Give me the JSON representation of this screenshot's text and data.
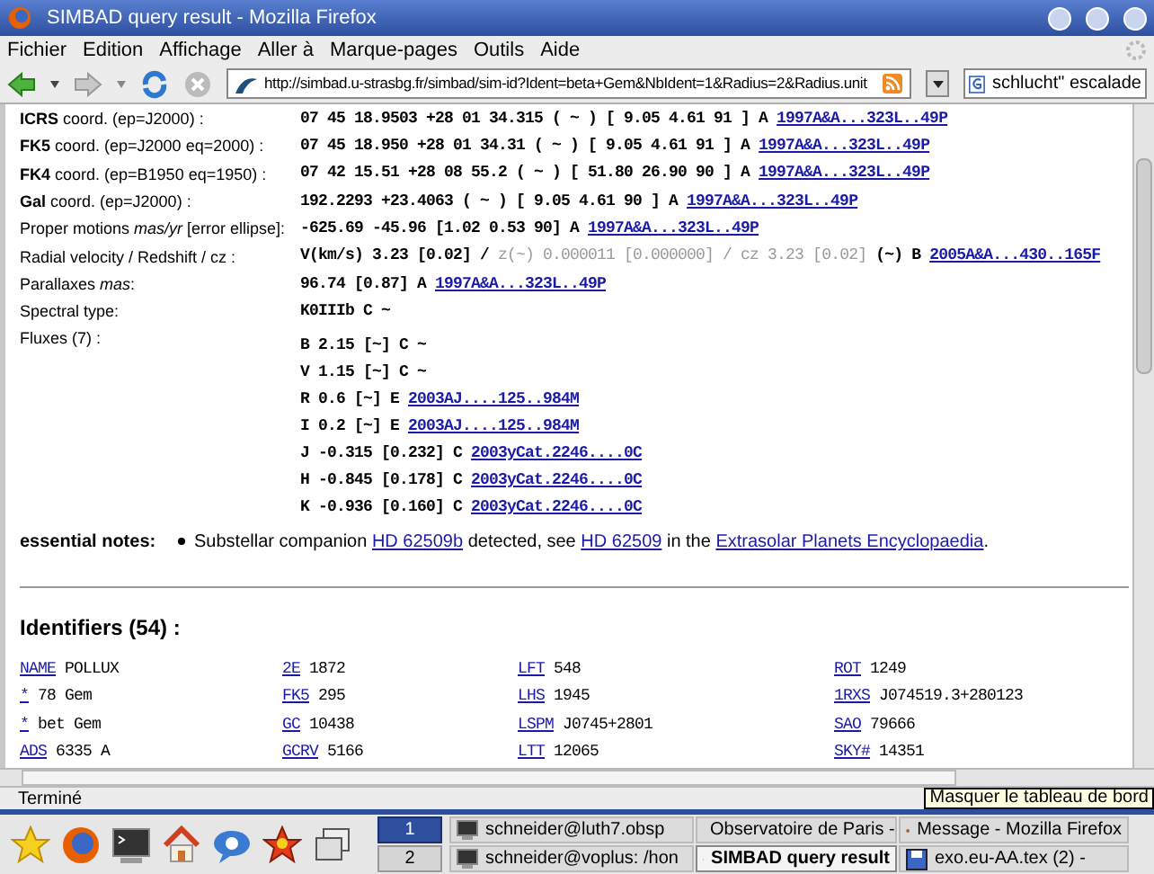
{
  "window": {
    "title": "SIMBAD query result - Mozilla Firefox"
  },
  "menu": [
    "Fichier",
    "Edition",
    "Affichage",
    "Aller à",
    "Marque-pages",
    "Outils",
    "Aide"
  ],
  "address_bar": {
    "value": "http://simbad.u-strasbg.fr/simbad/sim-id?Ident=beta+Gem&NbIdent=1&Radius=2&Radius.unit"
  },
  "search": {
    "value": "schlucht\" escalade"
  },
  "rows": [
    {
      "label": "**ICRS** coord. (ep=J2000) :",
      "segments": [
        {
          "kind": "text",
          "text": "07 45 18.9503 +28 01 34.315 ( ~ ) [ 9.05 4.61 91 ] A"
        },
        {
          "kind": "link",
          "text": "1997A&A...323L..49P"
        }
      ]
    },
    {
      "label": "**FK5** coord. (ep=J2000 eq=2000) :",
      "segments": [
        {
          "kind": "text",
          "text": "07 45 18.950 +28 01 34.31 ( ~ ) [ 9.05 4.61 91 ] A"
        },
        {
          "kind": "link",
          "text": "1997A&A...323L..49P"
        }
      ]
    },
    {
      "label": "**FK4** coord. (ep=B1950 eq=1950) :",
      "segments": [
        {
          "kind": "text",
          "text": "07 42 15.51 +28 08 55.2 ( ~ ) [ 51.80 26.90 90 ] A"
        },
        {
          "kind": "link",
          "text": "1997A&A...323L..49P"
        }
      ]
    },
    {
      "label": "**Gal** coord. (ep=J2000) :",
      "segments": [
        {
          "kind": "text",
          "text": "192.2293 +23.4063 ( ~ ) [ 9.05 4.61 90 ] A"
        },
        {
          "kind": "link",
          "text": "1997A&A...323L..49P"
        }
      ]
    },
    {
      "label": "Proper motions *mas/yr* [error ellipse]:",
      "segments": [
        {
          "kind": "text",
          "text": "-625.69 -45.96 [1.02 0.53 90] A"
        },
        {
          "kind": "link",
          "text": "1997A&A...323L..49P"
        }
      ]
    },
    {
      "label": "Radial velocity / Redshift / cz :",
      "segments": [
        {
          "kind": "text",
          "text": "V(km/s) 3.23 [0.02] /"
        },
        {
          "kind": "muted",
          "text": "z(~) 0.000011 [0.000000] / cz 3.23 [0.02]"
        },
        {
          "kind": "text",
          "text": "(~) B"
        },
        {
          "kind": "link",
          "text": "2005A&A...430..165F"
        }
      ]
    },
    {
      "label": "Parallaxes *mas*:",
      "segments": [
        {
          "kind": "text",
          "text": "96.74 [0.87] A"
        },
        {
          "kind": "link",
          "text": "1997A&A...323L..49P"
        }
      ]
    },
    {
      "label": "Spectral type:",
      "segments": [
        {
          "kind": "text",
          "text": "K0IIIb C ~"
        }
      ]
    }
  ],
  "fluxes": {
    "label": "Fluxes (7) :",
    "lines": [
      [
        {
          "kind": "text",
          "text": "B 2.15 [~] C ~"
        }
      ],
      [
        {
          "kind": "text",
          "text": "V 1.15 [~] C ~"
        }
      ],
      [
        {
          "kind": "text",
          "text": "R 0.6 [~] E"
        },
        {
          "kind": "link",
          "text": "2003AJ....125..984M"
        }
      ],
      [
        {
          "kind": "text",
          "text": "I 0.2 [~] E"
        },
        {
          "kind": "link",
          "text": "2003AJ....125..984M"
        }
      ],
      [
        {
          "kind": "text",
          "text": "J -0.315 [0.232] C"
        },
        {
          "kind": "link",
          "text": "2003yCat.2246....0C"
        }
      ],
      [
        {
          "kind": "text",
          "text": "H -0.845 [0.178] C"
        },
        {
          "kind": "link",
          "text": "2003yCat.2246....0C"
        }
      ],
      [
        {
          "kind": "text",
          "text": "K -0.936 [0.160] C"
        },
        {
          "kind": "link",
          "text": "2003yCat.2246....0C"
        }
      ]
    ]
  },
  "notes": {
    "label": "essential notes:",
    "items": [
      [
        {
          "kind": "text",
          "text": "Substellar companion "
        },
        {
          "kind": "link",
          "text": "HD 62509b"
        },
        {
          "kind": "text",
          "text": " detected, see "
        },
        {
          "kind": "link",
          "text": "HD 62509"
        },
        {
          "kind": "text",
          "text": " in the "
        },
        {
          "kind": "link",
          "text": "Extrasolar Planets Encyclopaedia"
        },
        {
          "kind": "text",
          "text": "."
        }
      ]
    ]
  },
  "identifiers": {
    "heading": "Identifiers (54) :",
    "items": [
      {
        "catalog": "NAME",
        "value": "POLLUX"
      },
      {
        "catalog": "2E",
        "value": "1872"
      },
      {
        "catalog": "LFT",
        "value": "548"
      },
      {
        "catalog": "ROT",
        "value": "1249"
      },
      {
        "catalog": "*",
        "value": "78 Gem"
      },
      {
        "catalog": "FK5",
        "value": "295"
      },
      {
        "catalog": "LHS",
        "value": "1945"
      },
      {
        "catalog": "1RXS",
        "value": "J074519.3+280123"
      },
      {
        "catalog": "*",
        "value": "bet Gem"
      },
      {
        "catalog": "GC",
        "value": "10438"
      },
      {
        "catalog": "LSPM",
        "value": "J0745+2801"
      },
      {
        "catalog": "SAO",
        "value": "79666"
      },
      {
        "catalog": "ADS",
        "value": "6335 A"
      },
      {
        "catalog": "GCRV",
        "value": "5166"
      },
      {
        "catalog": "LTT",
        "value": "12065"
      },
      {
        "catalog": "SKY#",
        "value": "14351"
      }
    ]
  },
  "status_bar": "Terminé",
  "taskbar": {
    "pager": [
      {
        "label": "1",
        "selected": true
      },
      {
        "label": "2",
        "selected": false
      }
    ],
    "tasks": [
      {
        "label": "schneider@luth7.obsp",
        "kind": "terminal",
        "selected": false
      },
      {
        "label": "Observatoire de Paris -",
        "kind": "browser",
        "selected": false
      },
      {
        "label": "Message - Mozilla Firefox",
        "kind": "browser",
        "selected": false
      },
      {
        "label": "schneider@voplus: /hon",
        "kind": "terminal",
        "selected": false
      },
      {
        "label": "SIMBAD query result",
        "kind": "browser",
        "selected": true
      },
      {
        "label": "exo.eu-AA.tex (2) -",
        "kind": "editor",
        "selected": false
      }
    ],
    "tooltip": "Masquer le tableau de bord"
  }
}
